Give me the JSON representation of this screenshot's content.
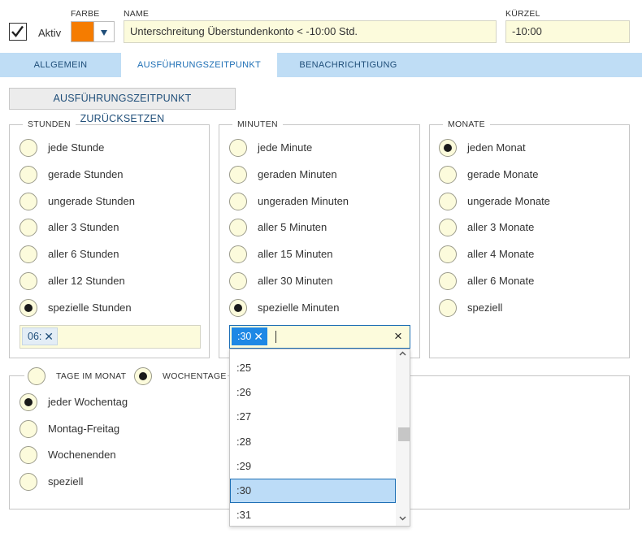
{
  "header": {
    "aktiv_label": "Aktiv",
    "aktiv_checked": true,
    "farbe_label": "FARBE",
    "farbe_color": "#f57c00",
    "name_label": "NAME",
    "name_value": "Unterschreitung Überstundenkonto < -10:00 Std.",
    "kuerzel_label": "KÜRZEL",
    "kuerzel_value": "-10:00"
  },
  "tabs": [
    {
      "label": "ALLGEMEIN",
      "active": false
    },
    {
      "label": "AUSFÜHRUNGSZEITPUNKT",
      "active": true
    },
    {
      "label": "BENACHRICHTIGUNG",
      "active": false
    }
  ],
  "reset_button": "AUSFÜHRUNGSZEITPUNKT ZURÜCKSETZEN",
  "stunden": {
    "legend": "STUNDEN",
    "options": [
      "jede Stunde",
      "gerade Stunden",
      "ungerade Stunden",
      "aller 3 Stunden",
      "aller 6 Stunden",
      "aller 12 Stunden",
      "spezielle Stunden"
    ],
    "selected_index": 6,
    "tags": [
      "06:"
    ]
  },
  "minuten": {
    "legend": "MINUTEN",
    "options": [
      "jede Minute",
      "geraden Minuten",
      "ungeraden Minuten",
      "aller 5 Minuten",
      "aller 15 Minuten",
      "aller 30 Minuten",
      "spezielle Minuten"
    ],
    "selected_index": 6,
    "tags": [
      ":30"
    ],
    "clear_icon": "×"
  },
  "monate": {
    "legend": "MONATE",
    "options": [
      "jeden Monat",
      "gerade Monate",
      "ungerade Monate",
      "aller 3 Monate",
      "aller 4 Monate",
      "aller 6 Monate",
      "speziell"
    ],
    "selected_index": 0
  },
  "tage": {
    "mode_options": [
      "TAGE IM MONAT",
      "WOCHENTAGE"
    ],
    "mode_selected_index": 1,
    "options": [
      "jeder Wochentag",
      "Montag-Freitag",
      "Wochenenden",
      "speziell"
    ],
    "selected_index": 0
  },
  "minute_dropdown": {
    "items": [
      ":25",
      ":26",
      ":27",
      ":28",
      ":29",
      ":30",
      ":31"
    ],
    "selected": ":30"
  },
  "icons": {
    "checkbox": "check-icon",
    "color_dropdown": "caret-down-icon",
    "tag_remove": "close-icon",
    "clear": "close-icon",
    "scroll_up": "chevron-up-icon",
    "scroll_down": "chevron-down-icon"
  }
}
